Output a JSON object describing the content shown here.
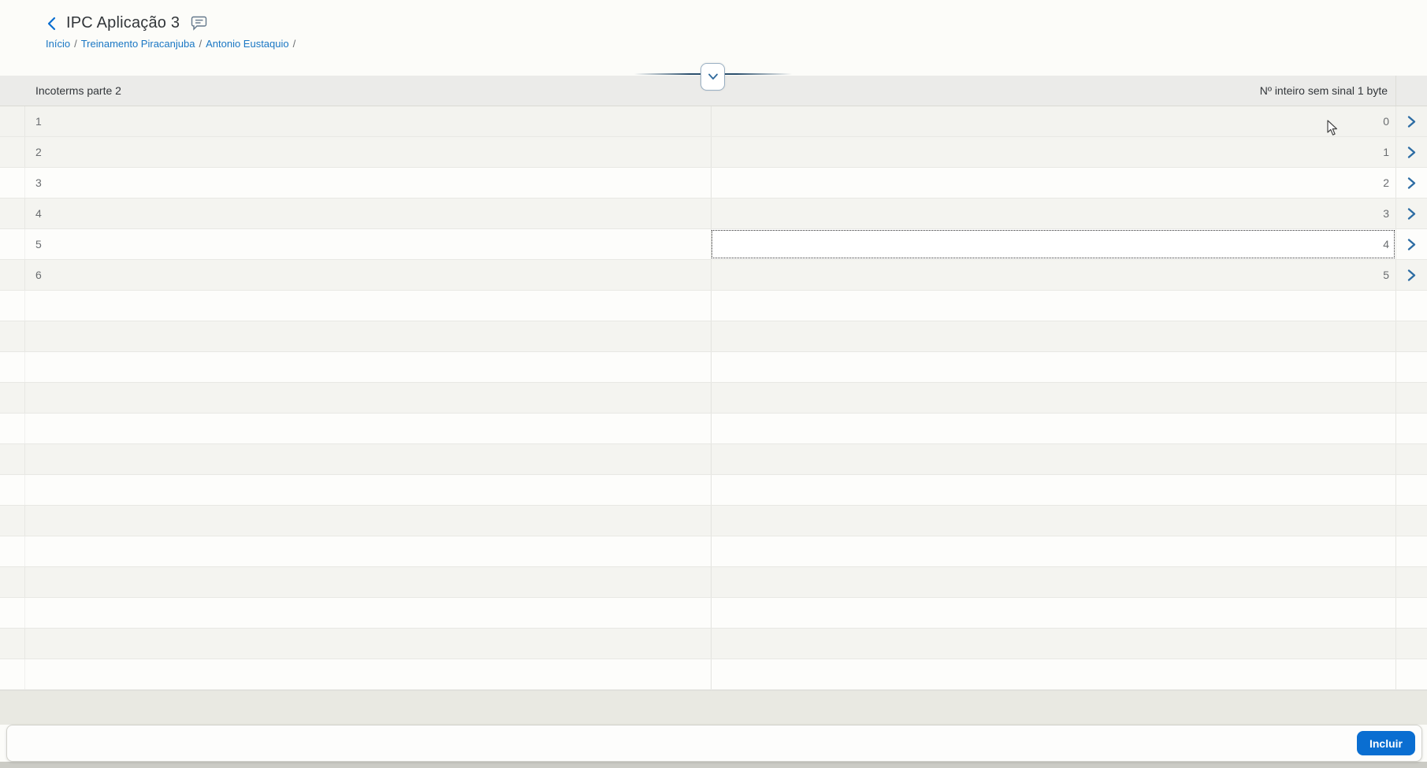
{
  "header": {
    "title": "IPC Aplicação 3",
    "breadcrumb": {
      "items": [
        "Início",
        "Treinamento Piracanjuba",
        "Antonio Eustaquio"
      ],
      "separator": "/"
    }
  },
  "icons": {
    "back": "chevron-left-icon",
    "comment": "comment-bubble-icon",
    "collapse": "chevron-down-icon",
    "row_nav": "chevron-right-icon",
    "cursor": "mouse-pointer"
  },
  "table": {
    "columns": [
      {
        "label": "Incoterms parte 2",
        "align": "left"
      },
      {
        "label": "Nº inteiro sem sinal 1 byte",
        "align": "right"
      }
    ],
    "rows": [
      {
        "c1": "1",
        "c2": "0",
        "hovered": true
      },
      {
        "c1": "2",
        "c2": "1"
      },
      {
        "c1": "3",
        "c2": "2"
      },
      {
        "c1": "4",
        "c2": "3"
      },
      {
        "c1": "5",
        "c2": "4",
        "focused": true
      },
      {
        "c1": "6",
        "c2": "5"
      }
    ],
    "empty_row_count": 13
  },
  "footer": {
    "button_label": "Incluir"
  },
  "colors": {
    "link_blue": "#1a77c4",
    "accent_blue": "#0a6ed1",
    "chevron_blue": "#2e6da4",
    "header_band": "#ebebe9",
    "alt_row": "#f4f4f0",
    "focus_outline": "#2f2f2f",
    "anchor_line": "#2b4f6d"
  }
}
